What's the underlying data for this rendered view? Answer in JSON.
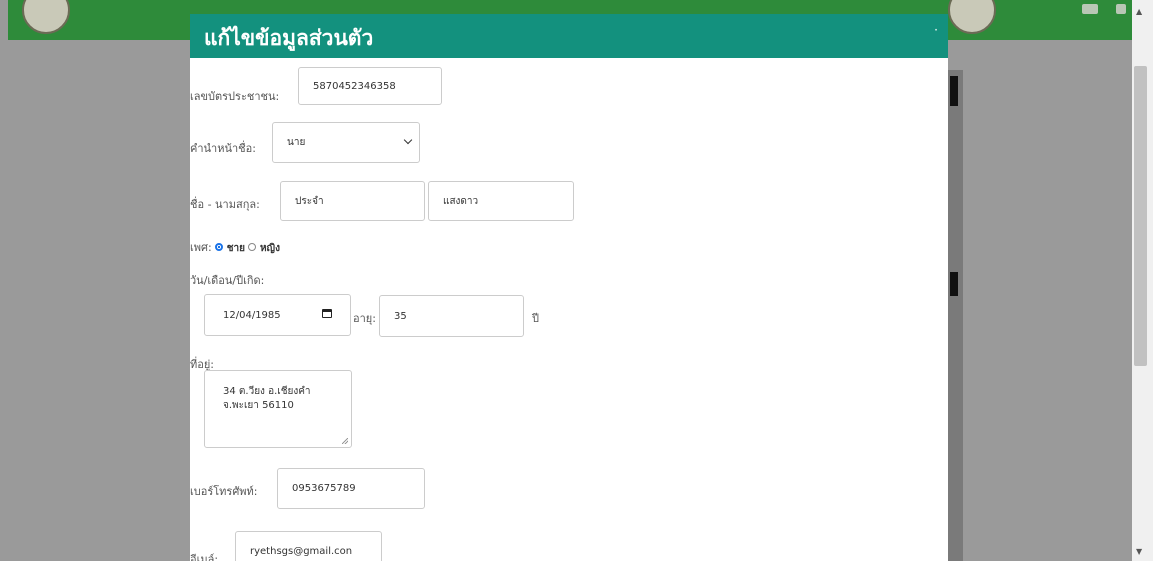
{
  "modal": {
    "title": "แก้ไขข้อมูลส่วนตัว",
    "close": "·"
  },
  "form": {
    "citizen_id": {
      "label": "เลขบัตรประชาชน:",
      "value": "5870452346358"
    },
    "prefix": {
      "label": "คำนำหน้าชื่อ:",
      "selected": "นาย"
    },
    "name": {
      "label": "ชื่อ - นามสกุล:",
      "first": "ประจำ",
      "last": "แสงดาว"
    },
    "gender": {
      "label": "เพศ:",
      "options": [
        "ชาย",
        "หญิง"
      ],
      "selected": "ชาย"
    },
    "birthdate": {
      "label": "วัน/เดือน/ปีเกิด:",
      "value": "12/04/1985"
    },
    "age": {
      "label": "อายุ:",
      "value": "35",
      "unit": "ปี"
    },
    "address": {
      "label": "ที่อยู่:",
      "value": "34 ต.วียง อ.เชียงคำ\nจ.พะเยา 56110"
    },
    "phone": {
      "label": "เบอร์โทรศัพท์:",
      "value": "0953675789"
    },
    "email": {
      "label": "อีเมล์:",
      "value": "ryethsgs@gmail.con"
    }
  },
  "colors": {
    "header": "#13917e",
    "topbar": "#2e8b3a",
    "overlay": "#9a9a9a",
    "radio": "#1a73e8"
  }
}
